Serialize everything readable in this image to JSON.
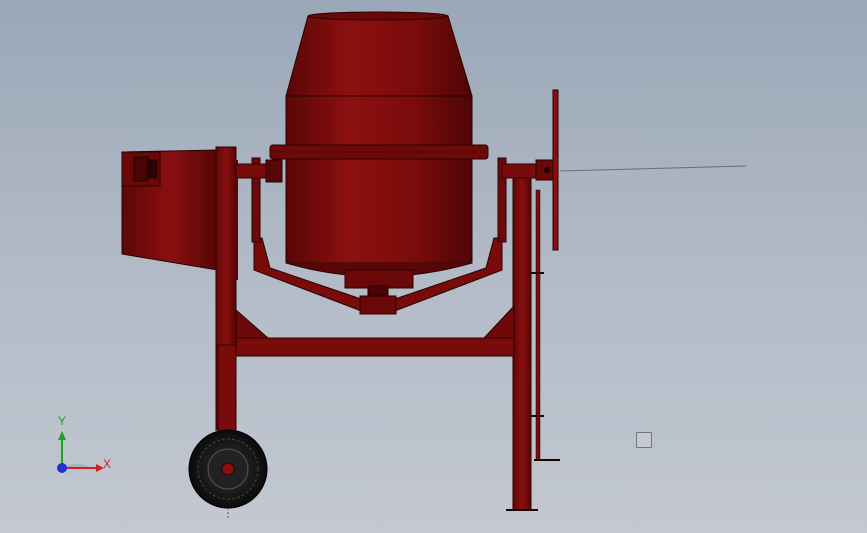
{
  "viewport": {
    "background_top": "#9aa7b7",
    "background_bottom": "#c3c8d1"
  },
  "model": {
    "name": "concrete-mixer",
    "body_color": "#7a0b0b",
    "edge_color": "#2a0202",
    "wheel_color": "#1a1a1a"
  },
  "triad": {
    "x_label": "X",
    "y_label": "Y",
    "x_color": "#d42020",
    "y_color": "#1aa41a",
    "z_color": "#2233cc"
  },
  "icons": {
    "view_toggle": "square-outline-icon"
  }
}
